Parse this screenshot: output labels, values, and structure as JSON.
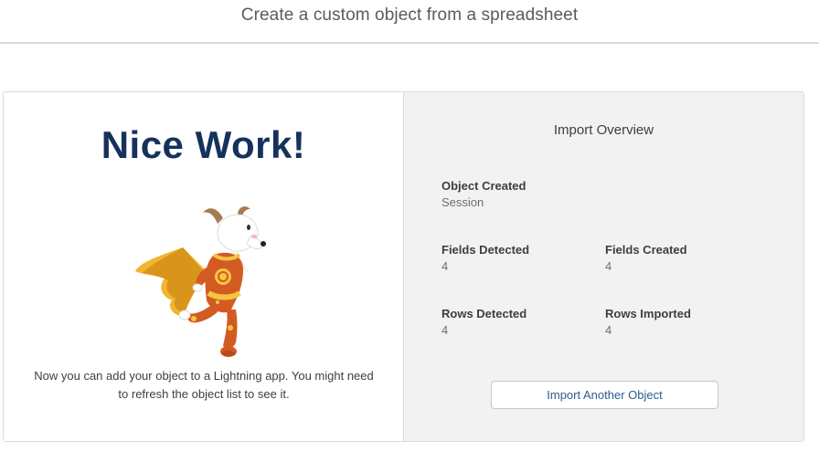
{
  "header": {
    "title": "Create a custom object from a spreadsheet"
  },
  "success": {
    "headline": "Nice Work!",
    "message": "Now you can add your object to a Lightning app. You might need to refresh the object list to see it.",
    "illustration": "superhero-goat-illustration"
  },
  "overview": {
    "title": "Import Overview",
    "object_created": {
      "label": "Object Created",
      "value": "Session"
    },
    "fields_detected": {
      "label": "Fields Detected",
      "value": "4"
    },
    "fields_created": {
      "label": "Fields Created",
      "value": "4"
    },
    "rows_detected": {
      "label": "Rows Detected",
      "value": "4"
    },
    "rows_imported": {
      "label": "Rows Imported",
      "value": "4"
    },
    "import_button_label": "Import Another Object"
  },
  "colors": {
    "headline": "#16325c",
    "panel_background": "#f3f2f2",
    "link_blue": "#2a5d91",
    "border": "#dddbda"
  }
}
